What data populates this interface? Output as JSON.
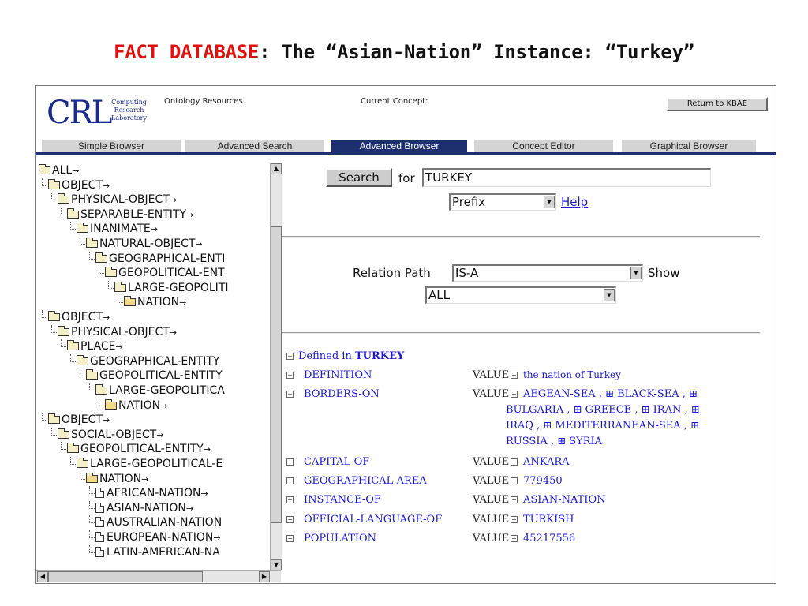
{
  "slide": {
    "title_red": "FACT DATABASE",
    "title_rest": ": The “Asian-Nation” Instance: “Turkey”"
  },
  "header": {
    "logo_main": "CRL",
    "logo_sub_1": "Computing",
    "logo_sub_2": "Research",
    "logo_sub_3": "Laboratory",
    "ontology_label": "Ontology Resources",
    "current_concept_label": "Current Concept:",
    "return_button": "Return to KBAE"
  },
  "tabs": [
    {
      "label": "Simple Browser"
    },
    {
      "label": "Advanced Search"
    },
    {
      "label": "Advanced Browser",
      "active": true
    },
    {
      "label": "Concept Editor"
    },
    {
      "label": "Graphical Browser"
    }
  ],
  "tree": [
    {
      "label": "ALL",
      "arrow": "→",
      "level": 0,
      "icon": "folder"
    },
    {
      "label": "OBJECT",
      "arrow": "→",
      "level": 1,
      "icon": "folder"
    },
    {
      "label": "PHYSICAL-OBJECT",
      "arrow": "→",
      "level": 2,
      "icon": "folder"
    },
    {
      "label": "SEPARABLE-ENTITY",
      "arrow": "→",
      "level": 3,
      "icon": "folder"
    },
    {
      "label": "INANIMATE",
      "arrow": "→",
      "level": 4,
      "icon": "folder"
    },
    {
      "label": "NATURAL-OBJECT",
      "arrow": "→",
      "level": 5,
      "icon": "folder"
    },
    {
      "label": "GEOGRAPHICAL-ENTI",
      "arrow": "",
      "level": 6,
      "icon": "folder"
    },
    {
      "label": "GEOPOLITICAL-ENT",
      "arrow": "",
      "level": 7,
      "icon": "folder"
    },
    {
      "label": "LARGE-GEOPOLITI",
      "arrow": "",
      "level": 8,
      "icon": "folder"
    },
    {
      "label": "NATION",
      "arrow": "→",
      "level": 9,
      "icon": "folder-open"
    },
    {
      "label": "OBJECT",
      "arrow": "→",
      "level": 1,
      "icon": "folder"
    },
    {
      "label": "PHYSICAL-OBJECT",
      "arrow": "→",
      "level": 2,
      "icon": "folder"
    },
    {
      "label": "PLACE",
      "arrow": "→",
      "level": 3,
      "icon": "folder"
    },
    {
      "label": "GEOGRAPHICAL-ENTITY",
      "arrow": "",
      "level": 4,
      "icon": "folder"
    },
    {
      "label": "GEOPOLITICAL-ENTITY",
      "arrow": "",
      "level": 5,
      "icon": "folder"
    },
    {
      "label": "LARGE-GEOPOLITICA",
      "arrow": "",
      "level": 6,
      "icon": "folder"
    },
    {
      "label": "NATION",
      "arrow": "→",
      "level": 7,
      "icon": "folder-open"
    },
    {
      "label": "OBJECT",
      "arrow": "→",
      "level": 1,
      "icon": "folder"
    },
    {
      "label": "SOCIAL-OBJECT",
      "arrow": "→",
      "level": 2,
      "icon": "folder"
    },
    {
      "label": "GEOPOLITICAL-ENTITY",
      "arrow": "→",
      "level": 3,
      "icon": "folder"
    },
    {
      "label": "LARGE-GEOPOLITICAL-E",
      "arrow": "",
      "level": 4,
      "icon": "folder"
    },
    {
      "label": "NATION",
      "arrow": "→",
      "level": 5,
      "icon": "folder-open"
    },
    {
      "label": "AFRICAN-NATION",
      "arrow": "→",
      "level": 6,
      "icon": "doc"
    },
    {
      "label": "ASIAN-NATION",
      "arrow": "→",
      "level": 6,
      "icon": "doc"
    },
    {
      "label": "AUSTRALIAN-NATION",
      "arrow": "",
      "level": 6,
      "icon": "doc"
    },
    {
      "label": "EUROPEAN-NATION",
      "arrow": "→",
      "level": 6,
      "icon": "doc"
    },
    {
      "label": "LATIN-AMERICAN-NA",
      "arrow": "",
      "level": 6,
      "icon": "doc"
    }
  ],
  "search": {
    "button": "Search",
    "for_label": "for",
    "query": "TURKEY",
    "match_mode": "Prefix",
    "help_link": "Help"
  },
  "relation": {
    "label": "Relation Path",
    "path_value": "IS-A",
    "show_label": "Show",
    "show_value": "ALL"
  },
  "facts": {
    "defined_prefix": "Defined in",
    "defined_concept": "TURKEY",
    "value_keyword": "VALUE",
    "rows": [
      {
        "slot": "DEFINITION",
        "values": [
          "the nation of Turkey"
        ]
      },
      {
        "slot": "BORDERS-ON",
        "lines": [
          "AEGEAN-SEA ,  ⊞  BLACK-SEA ,  ⊞",
          "BULGARIA ,  ⊞  GREECE ,  ⊞  IRAN ,  ⊞",
          "IRAQ ,  ⊞  MEDITERRANEAN-SEA ,  ⊞",
          "RUSSIA ,  ⊞  SYRIA"
        ]
      },
      {
        "slot": "CAPITAL-OF",
        "values": [
          "ANKARA"
        ]
      },
      {
        "slot": "GEOGRAPHICAL-AREA",
        "values": [
          "779450"
        ]
      },
      {
        "slot": "INSTANCE-OF",
        "values": [
          "ASIAN-NATION"
        ]
      },
      {
        "slot": "OFFICIAL-LANGUAGE-OF",
        "values": [
          "TURKISH"
        ]
      },
      {
        "slot": "POPULATION",
        "values": [
          "45217556"
        ]
      }
    ]
  }
}
